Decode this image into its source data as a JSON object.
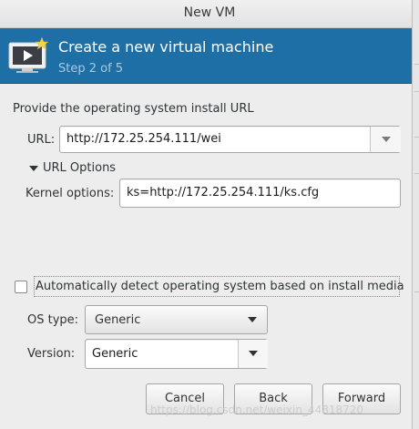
{
  "window": {
    "title": "New VM"
  },
  "header": {
    "title": "Create a new virtual machine",
    "step": "Step 2 of 5",
    "icon": "vm-monitor-icon"
  },
  "install": {
    "prompt": "Provide the operating system install URL",
    "url_label": "URL:",
    "url_value": "http://172.25.254.111/wei",
    "url_options_label": "URL Options",
    "kernel_label": "Kernel options:",
    "kernel_value": "ks=http://172.25.254.111/ks.cfg"
  },
  "os": {
    "auto_detect_label": "Automatically detect operating system based on install media",
    "auto_detect_checked": false,
    "os_type_label": "OS type:",
    "os_type_value": "Generic",
    "version_label": "Version:",
    "version_value": "Generic"
  },
  "buttons": {
    "cancel": "Cancel",
    "back": "Back",
    "forward": "Forward"
  },
  "watermark": "https://blog.csdn.net/weixin_44818720",
  "colors": {
    "header_blue": "#1d6fa5",
    "step_text": "#a7cae3"
  }
}
